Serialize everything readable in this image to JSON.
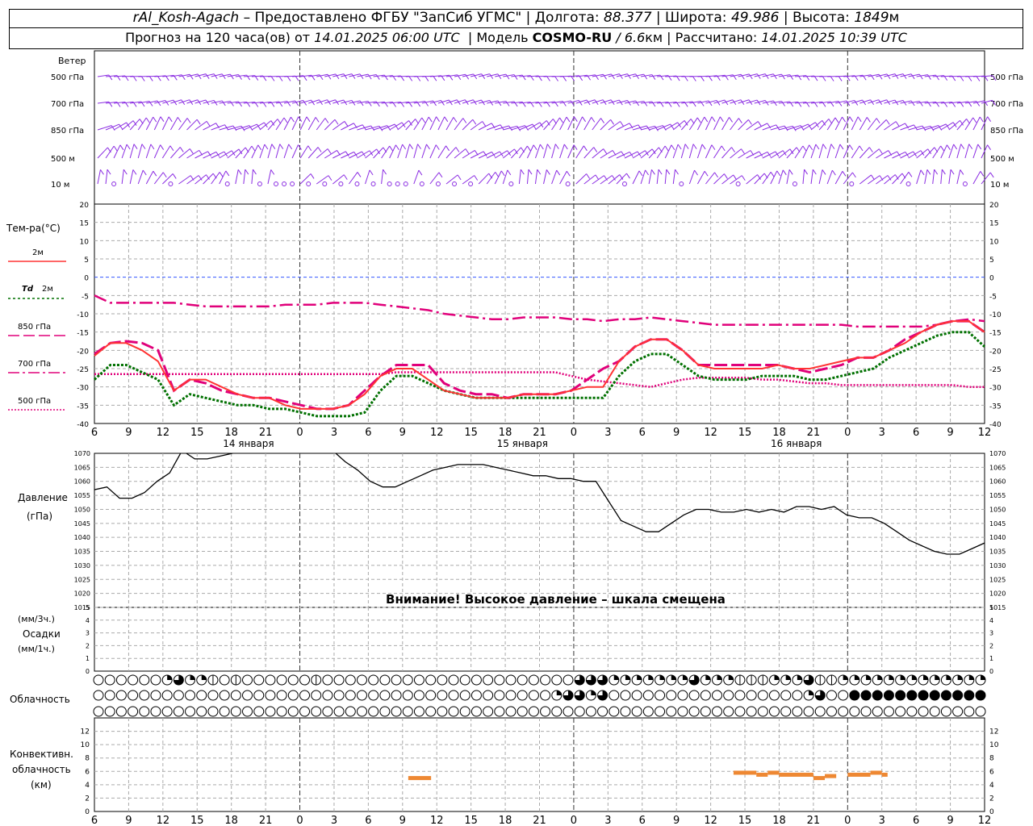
{
  "header": {
    "station": "rAl_Kosh-Agach",
    "provided": "– Предоставлено ФГБУ \"ЗапСиб УГМС\"",
    "lon_label": "| Долгота:",
    "lon": "88.377",
    "lat_label": "| Широта:",
    "lat": "49.986",
    "alt_label": "| Высота:",
    "alt": "1849",
    "alt_unit": "м",
    "fc_label": "Прогноз на 120 часа(ов) от",
    "fc_time": "14.01.2025 06:00 UTC",
    "model_label": "| Модель",
    "model": "COSMO-RU",
    "res": "/ 6.6",
    "res_unit": "км",
    "calc_label": "| Рассчитано:",
    "calc_time": "14.01.2025 10:39 UTC"
  },
  "labels": {
    "wind": "Ветер",
    "wind_levels": [
      "500 гПа",
      "700 гПа",
      "850 гПа",
      "500 м",
      "10 м"
    ],
    "temp": "Тем-ра(°C)",
    "t2m": "2м",
    "td": "Td",
    "td2m": "2м",
    "t850": "850 гПа",
    "t700": "700 гПа",
    "t500": "500 гПа",
    "pressure": "Давление",
    "pressure_unit": "(гПа)",
    "warning": "Внимание! Высокое давление – шкала смещена",
    "precip_unit1": "(мм/3ч.)",
    "precip": "Осадки",
    "precip_unit2": "(мм/1ч.)",
    "cloud": "Облачность",
    "conv1": "Конвективн.",
    "conv2": "облачность",
    "conv3": "(км)"
  },
  "colors": {
    "t2m": "#ff3333",
    "td": "#007000",
    "t850": "#e0007a",
    "t700": "#e0007a",
    "t500": "#e0007a",
    "wind": "#8a2be2",
    "pressure": "#000000",
    "conv": "#ee8833",
    "zero": "#3355ff"
  },
  "chart_data": {
    "type": "line",
    "time_ticks": [
      "6",
      "9",
      "12",
      "15",
      "18",
      "21",
      "0",
      "3",
      "6",
      "9",
      "12",
      "15",
      "18",
      "21",
      "0",
      "3",
      "6",
      "9",
      "12",
      "15",
      "18",
      "21",
      "0",
      "3",
      "6",
      "9",
      "12"
    ],
    "day_labels": [
      {
        "text": "14 января",
        "at": 4.5
      },
      {
        "text": "15 января",
        "at": 12.5
      },
      {
        "text": "16 января",
        "at": 20.5
      }
    ],
    "temperature": {
      "ylim": [
        -40,
        20
      ],
      "ticks": [
        "20",
        "15",
        "10",
        "5",
        "0",
        "-5",
        "-10",
        "-15",
        "-20",
        "-25",
        "-30",
        "-35",
        "-40"
      ],
      "t2m": [
        -21.5,
        -18,
        -18,
        -20,
        -23,
        -31,
        -28,
        -28,
        -30,
        -32,
        -33,
        -33,
        -35,
        -36,
        -36,
        -36,
        -35,
        -32,
        -27,
        -25,
        -25,
        -28,
        -31,
        -32,
        -33,
        -33,
        -33,
        -32,
        -32,
        -32,
        -31,
        -30,
        -30,
        -23,
        -19,
        -17,
        -17,
        -20,
        -24,
        -25,
        -25,
        -25,
        -25,
        -24,
        -25,
        -25,
        -24,
        -23,
        -22,
        -22,
        -20,
        -18,
        -15,
        -13,
        -12,
        -12,
        -15
      ],
      "td2m": [
        -28,
        -24,
        -24,
        -26,
        -28,
        -35,
        -32,
        -33,
        -34,
        -35,
        -35,
        -36,
        -36,
        -37,
        -38,
        -38,
        -38,
        -37,
        -31,
        -27,
        -27,
        -29,
        -31,
        -32,
        -33,
        -33,
        -33,
        -33,
        -33,
        -33,
        -33,
        -33,
        -33,
        -27,
        -23,
        -21,
        -21,
        -24,
        -27,
        -28,
        -28,
        -28,
        -27,
        -27,
        -27,
        -28,
        -28,
        -27,
        -26,
        -25,
        -22,
        -20,
        -18,
        -16,
        -15,
        -15,
        -19
      ],
      "t850": [
        -21,
        -18,
        -17.5,
        -18,
        -20,
        -31,
        -28,
        -29,
        -31,
        -32,
        -33,
        -33,
        -34,
        -35,
        -36,
        -36,
        -35,
        -31,
        -27,
        -24,
        -24,
        -24,
        -29,
        -31,
        -32,
        -32,
        -33,
        -32,
        -32,
        -32,
        -31,
        -28,
        -25,
        -23,
        -19,
        -17,
        -17,
        -20,
        -24,
        -24,
        -24,
        -24,
        -24,
        -24,
        -25,
        -26,
        -25,
        -24,
        -22,
        -22,
        -20,
        -17,
        -15,
        -13,
        -12,
        -12,
        -15
      ],
      "t700": [
        -5,
        -7,
        -7,
        -7,
        -7,
        -7,
        -7.5,
        -8,
        -8,
        -8,
        -8,
        -8,
        -7.5,
        -7.5,
        -7.5,
        -7,
        -7,
        -7,
        -7.5,
        -8,
        -8.5,
        -9,
        -10,
        -10.5,
        -11,
        -11.5,
        -11.5,
        -11,
        -11,
        -11,
        -11.5,
        -11.5,
        -12,
        -11.5,
        -11.5,
        -11,
        -11.5,
        -12,
        -12.5,
        -13,
        -13,
        -13,
        -13,
        -13,
        -13,
        -13,
        -13,
        -13,
        -13.5,
        -13.5,
        -13.5,
        -13.5,
        -13.5,
        -13,
        -12,
        -11.5,
        -12
      ],
      "t500": [
        -26.5,
        -26.5,
        -26.5,
        -26.5,
        -26.5,
        -26.5,
        -26.5,
        -26.5,
        -26.5,
        -26.5,
        -26.5,
        -26.5,
        -26.5,
        -26.5,
        -26.5,
        -26.5,
        -26.5,
        -26.5,
        -26.5,
        -26,
        -26,
        -26,
        -26,
        -26,
        -26,
        -26,
        -26,
        -26,
        -26,
        -26,
        -27,
        -28,
        -28.5,
        -29,
        -29.5,
        -30,
        -29,
        -28,
        -27.5,
        -27.5,
        -27.5,
        -27.5,
        -28,
        -28,
        -28.5,
        -29,
        -29,
        -29.5,
        -29.5,
        -29.5,
        -29.5,
        -29.5,
        -29.5,
        -29.5,
        -29.5,
        -30,
        -30
      ]
    },
    "pressure": {
      "ylim": [
        1015,
        1070
      ],
      "ticks": [
        "1070",
        "1065",
        "1060",
        "1055",
        "1050",
        "1045",
        "1040",
        "1035",
        "1030",
        "1025",
        "1020",
        "1015"
      ],
      "values": [
        1057,
        1058,
        1054,
        1054,
        1056,
        1060,
        1063,
        1071,
        1068,
        1068,
        1069,
        1070,
        1073,
        1075,
        1076,
        1077,
        1076,
        1075,
        1073,
        1071,
        1067,
        1064,
        1060,
        1058,
        1058,
        1060,
        1062,
        1064,
        1065,
        1066,
        1066,
        1066,
        1065,
        1064,
        1063,
        1062,
        1062,
        1061,
        1061,
        1060,
        1060,
        1053,
        1046,
        1044,
        1042,
        1042,
        1045,
        1048,
        1050,
        1050,
        1049,
        1049,
        1050,
        1049,
        1050,
        1049,
        1051,
        1051,
        1050,
        1051,
        1048,
        1047,
        1047,
        1045,
        1042,
        1039,
        1037,
        1035,
        1034,
        1034,
        1036,
        1038
      ]
    },
    "precipitation": {
      "ylim": [
        0,
        5
      ],
      "ticks": [
        "5",
        "4",
        "3",
        "2",
        "1",
        "0"
      ],
      "values": []
    },
    "cloud_cover": {
      "high": [
        0,
        0,
        0,
        0,
        0,
        0,
        0,
        3,
        2,
        3,
        3,
        2,
        2,
        1,
        1,
        0,
        1,
        1,
        0,
        0,
        0,
        0,
        0,
        0,
        0,
        1,
        1,
        0,
        0,
        0,
        0,
        0,
        0,
        0,
        0,
        0,
        0,
        0,
        0,
        0,
        0,
        0,
        0,
        1,
        0,
        0,
        0,
        0,
        0,
        0,
        0,
        0,
        0,
        0,
        0,
        0,
        0,
        0,
        3,
        3,
        3,
        2,
        2,
        2,
        2,
        2,
        2,
        2,
        2,
        2,
        2,
        3,
        3,
        2,
        2,
        2,
        2,
        1,
        1,
        1,
        1,
        2,
        2,
        2,
        2,
        3,
        2,
        1,
        1,
        1,
        2,
        2,
        2,
        2,
        2,
        2,
        2,
        2,
        2,
        2,
        2,
        2,
        2,
        2,
        2,
        2,
        2,
        2
      ],
      "mid": [
        0,
        0,
        0,
        0,
        0,
        0,
        0,
        0,
        0,
        0,
        0,
        0,
        0,
        0,
        0,
        0,
        0,
        0,
        0,
        0,
        0,
        0,
        0,
        0,
        0,
        0,
        0,
        0,
        0,
        0,
        0,
        0,
        0,
        0,
        0,
        0,
        0,
        0,
        0,
        0,
        0,
        0,
        0,
        0,
        0,
        0,
        0,
        0,
        0,
        0,
        0,
        0,
        0,
        0,
        0,
        0,
        0,
        0,
        0,
        0,
        0,
        0,
        0,
        0,
        0,
        0,
        0,
        0,
        0,
        0,
        0,
        2,
        3,
        3,
        3,
        3,
        2,
        3,
        3,
        0,
        0,
        0,
        0,
        0,
        0,
        0,
        0,
        0,
        0,
        0,
        0,
        0,
        0,
        0,
        0,
        0,
        0,
        0,
        0,
        0,
        0,
        0,
        0,
        0,
        0,
        0,
        0,
        0,
        0,
        0,
        2,
        0,
        3,
        0,
        0,
        0,
        4,
        4,
        4,
        4,
        4,
        4,
        4,
        4,
        4,
        4,
        4,
        4,
        4,
        4,
        4,
        4,
        4,
        4,
        4,
        4,
        4,
        4,
        2
      ],
      "low": [
        0,
        0,
        0,
        0,
        0,
        0,
        0,
        0,
        0,
        0,
        0,
        0,
        0,
        0,
        0,
        0,
        0,
        0,
        0,
        0,
        0,
        0,
        0,
        0,
        0,
        0,
        0,
        0,
        0,
        0,
        0,
        0,
        0,
        0,
        0,
        0,
        0,
        0,
        0,
        0,
        0,
        0,
        0,
        0,
        0,
        0,
        0,
        0,
        0,
        0,
        0,
        0,
        0,
        0,
        0,
        0,
        0,
        0,
        0,
        0,
        0,
        0,
        0,
        0,
        0,
        0,
        0,
        0,
        0,
        0,
        0,
        0,
        0,
        0,
        0,
        0,
        0,
        0,
        0,
        0,
        0,
        0,
        0,
        0,
        0,
        0,
        0,
        0,
        0,
        0,
        0,
        0,
        0,
        0,
        0,
        0,
        0,
        0,
        0,
        0,
        0,
        0,
        0,
        0,
        0,
        0,
        0,
        0,
        0,
        0,
        0,
        0,
        0,
        0,
        0,
        0,
        0,
        0,
        0,
        0,
        0,
        0,
        0,
        0,
        0,
        0,
        0,
        0,
        0,
        0,
        0,
        0,
        0,
        0,
        0,
        0,
        0,
        0,
        0,
        0
      ]
    },
    "convective_cloud": {
      "ylim": [
        0,
        14
      ],
      "ticks": [
        "12",
        "10",
        "8",
        "6",
        "4",
        "2",
        "0"
      ],
      "segments": [
        {
          "t0": 27.5,
          "t1": 29.5,
          "h": 5.0
        },
        {
          "t0": 56.0,
          "t1": 58.0,
          "h": 5.8
        },
        {
          "t0": 58.0,
          "t1": 59.0,
          "h": 5.5
        },
        {
          "t0": 59.0,
          "t1": 60.0,
          "h": 5.8
        },
        {
          "t0": 60.0,
          "t1": 63.0,
          "h": 5.5
        },
        {
          "t0": 63.0,
          "t1": 64.0,
          "h": 5.0
        },
        {
          "t0": 64.0,
          "t1": 65.0,
          "h": 5.3
        },
        {
          "t0": 66.0,
          "t1": 68.0,
          "h": 5.5
        },
        {
          "t0": 68.0,
          "t1": 69.0,
          "h": 5.8
        },
        {
          "t0": 69.0,
          "t1": 69.5,
          "h": 5.5
        }
      ]
    }
  }
}
